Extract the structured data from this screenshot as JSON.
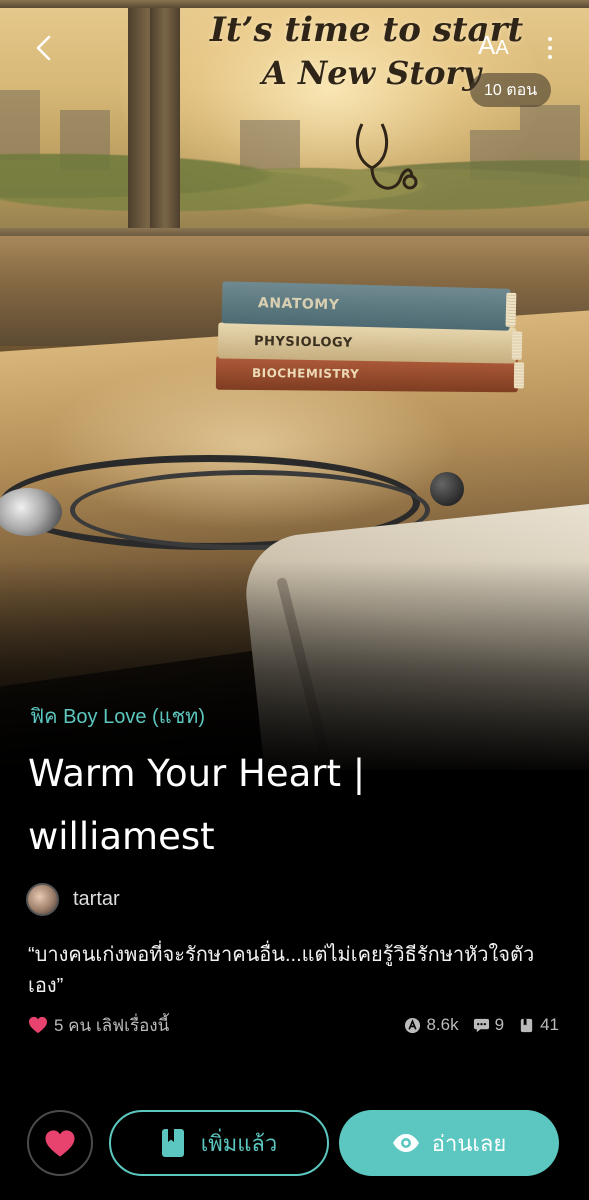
{
  "cover": {
    "headline_line1": "It’s time to start",
    "headline_line2": "A New Story",
    "book_labels": [
      "ANATOMY",
      "PHYSIOLOGY",
      "BIOCHEMISTRY"
    ]
  },
  "topbar": {
    "back_icon": "chevron-left-icon",
    "font_size_label_big": "A",
    "font_size_label_small": "A",
    "more_icon": "more-vertical-icon",
    "episode_badge": "10 ตอน"
  },
  "story": {
    "genre": "ฟิค Boy Love (แชท)",
    "title": "Warm Your Heart | williamest",
    "author": "tartar",
    "synopsis": "“บางคนเก่งพอที่จะรักษาคนอื่น...แต่ไม่เคยรู้วิธีรักษาหัวใจตัวเอง”",
    "love_text": "5 คน เลิฟเรื่องนี้",
    "stats": {
      "views": "8.6k",
      "comments": "9",
      "episodes": "41"
    }
  },
  "actions": {
    "favorite_icon": "heart-icon",
    "library_label": "เพิ่มแล้ว",
    "read_label": "อ่านเลย"
  },
  "colors": {
    "accent": "#5cc7c0",
    "heart": "#e8436f",
    "background": "#000000"
  }
}
